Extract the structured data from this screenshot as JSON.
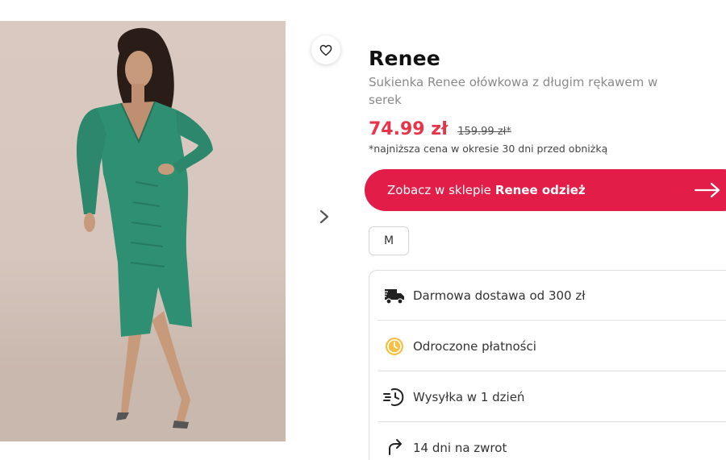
{
  "product": {
    "brand": "Renee",
    "description": "Sukienka Renee ołówkowa z długim rękawem w serek",
    "price_current": "74.99 zł",
    "price_old": "159.99 zł*",
    "lowest_price_note": "*najniższa cena w okresie 30 dni przed obniżką",
    "image_alt": "Model in green wrap midi dress",
    "dress_color": "#2f8f73",
    "accent_color": "#e11d48",
    "price_color": "#e8344a"
  },
  "cta": {
    "prefix": "Zobacz w sklepie",
    "shop_name": "Renee odzież",
    "icon": "arrow-right-icon"
  },
  "sizes": [
    "M"
  ],
  "benefits": [
    {
      "icon": "truck-icon",
      "label": "Darmowa dostawa od 300 zł"
    },
    {
      "icon": "clock-coin-icon",
      "label": "Odroczone płatności"
    },
    {
      "icon": "fast-clock-icon",
      "label": "Wysyłka w 1 dzień"
    },
    {
      "icon": "return-arrow-icon",
      "label": "14 dni na zwrot"
    }
  ]
}
